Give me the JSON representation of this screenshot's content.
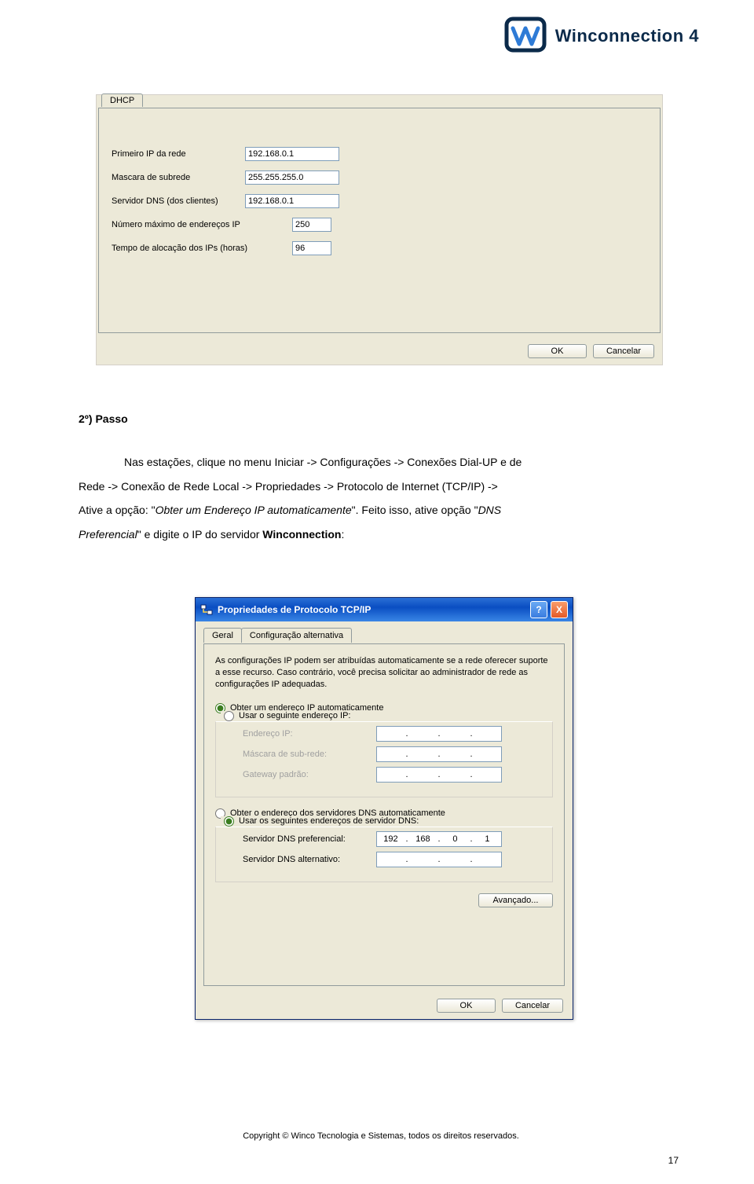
{
  "brand": {
    "text": "Winconnection 4"
  },
  "dhcp": {
    "tab": "DHCP",
    "rows": {
      "r1_label": "Primeiro IP da rede",
      "r1_value": "192.168.0.1",
      "r2_label": "Mascara de subrede",
      "r2_value": "255.255.255.0",
      "r3_label": "Servidor DNS (dos clientes)",
      "r3_value": "192.168.0.1",
      "r4_label": "Número máximo de endereços IP",
      "r4_value": "250",
      "r5_label": "Tempo de alocação dos IPs (horas)",
      "r5_value": "96"
    },
    "ok": "OK",
    "cancel": "Cancelar"
  },
  "para": {
    "step": "2º) Passo",
    "l1a": "Nas estações, clique no menu Iniciar -> Configurações -> Conexões Dial-UP e de",
    "l2a": "Rede -> Conexão de Rede Local -> Propriedades -> Protocolo de Internet (TCP/IP) ->",
    "l3a": "Ative a opção: \"",
    "l3i": "Obter um Endereço IP automaticamente",
    "l3b": "\". Feito isso, ative opção \"",
    "l3c": "DNS",
    "l4i": "Preferencial",
    "l4b": "\" e digite o IP do servidor ",
    "l4bold": "Winconnection",
    "l4c": ":"
  },
  "tcpip": {
    "title": "Propriedades de Protocolo TCP/IP",
    "help": "?",
    "close": "X",
    "tab_general": "Geral",
    "tab_alt": "Configuração alternativa",
    "info": "As configurações IP podem ser atribuídas automaticamente se a rede oferecer suporte a esse recurso. Caso contrário, você precisa solicitar ao administrador de rede as configurações IP adequadas.",
    "r_auto_ip": "Obter um endereço IP automaticamente",
    "r_static_ip": "Usar o seguinte endereço IP:",
    "f_ip": "Endereço IP:",
    "f_mask": "Máscara de sub-rede:",
    "f_gw": "Gateway padrão:",
    "r_auto_dns": "Obter o endereço dos servidores DNS automaticamente",
    "r_static_dns": "Usar os seguintes endereços de servidor DNS:",
    "f_dns1": "Servidor DNS preferencial:",
    "f_dns2": "Servidor DNS alternativo:",
    "dns1": {
      "a": "192",
      "b": "168",
      "c": "0",
      "d": "1"
    },
    "advanced": "Avançado...",
    "ok": "OK",
    "cancel": "Cancelar"
  },
  "footer": {
    "copyright": "Copyright © Winco Tecnologia e Sistemas, todos os direitos reservados.",
    "page": "17"
  }
}
